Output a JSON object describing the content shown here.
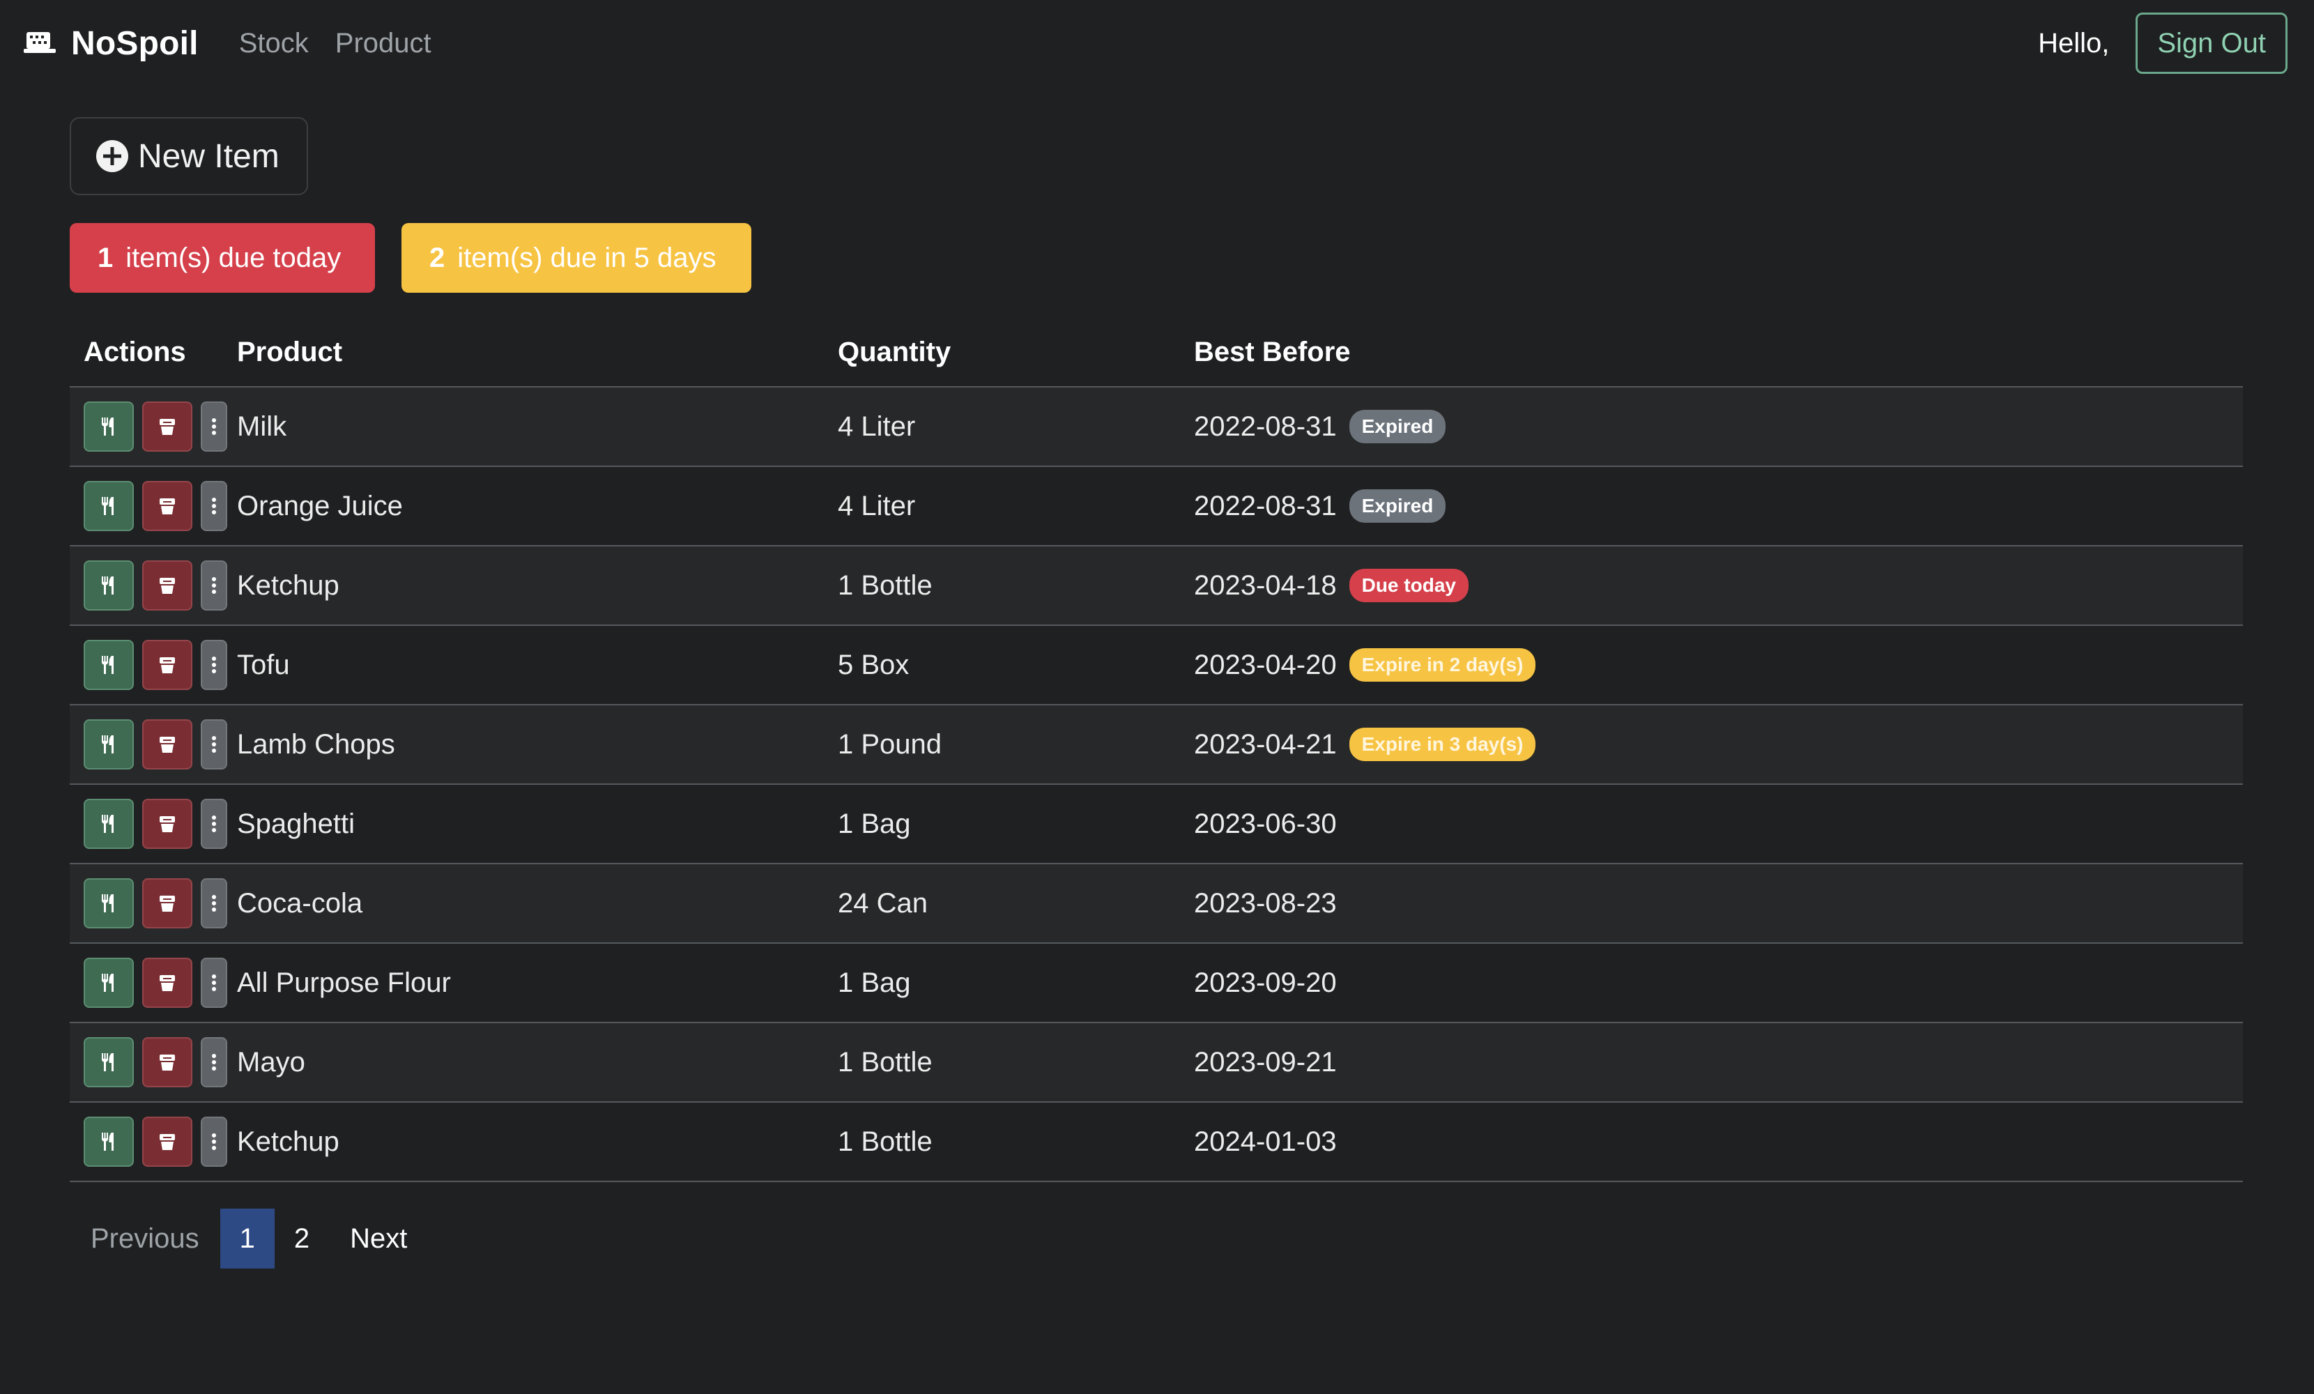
{
  "navbar": {
    "brand": "NoSpoil",
    "links": [
      "Stock",
      "Product"
    ],
    "greeting": "Hello,",
    "sign_out": "Sign Out"
  },
  "toolbar": {
    "new_item_label": "New Item"
  },
  "alerts": {
    "due_today": {
      "count": "1",
      "text": "item(s) due today",
      "color": "#d5404b"
    },
    "due_soon": {
      "count": "2",
      "text": "item(s) due in 5 days",
      "color": "#f7c343"
    }
  },
  "table": {
    "headers": [
      "Actions",
      "Product",
      "Quantity",
      "Best Before"
    ],
    "rows": [
      {
        "product": "Milk",
        "quantity": "4 Liter",
        "best_before": "2022-08-31",
        "badge": "Expired",
        "badge_type": "gray"
      },
      {
        "product": "Orange Juice",
        "quantity": "4 Liter",
        "best_before": "2022-08-31",
        "badge": "Expired",
        "badge_type": "gray"
      },
      {
        "product": "Ketchup",
        "quantity": "1 Bottle",
        "best_before": "2023-04-18",
        "badge": "Due today",
        "badge_type": "red"
      },
      {
        "product": "Tofu",
        "quantity": "5 Box",
        "best_before": "2023-04-20",
        "badge": "Expire in 2 day(s)",
        "badge_type": "yellow"
      },
      {
        "product": "Lamb Chops",
        "quantity": "1 Pound",
        "best_before": "2023-04-21",
        "badge": "Expire in 3 day(s)",
        "badge_type": "yellow"
      },
      {
        "product": "Spaghetti",
        "quantity": "1 Bag",
        "best_before": "2023-06-30",
        "badge": "",
        "badge_type": ""
      },
      {
        "product": "Coca-cola",
        "quantity": "24 Can",
        "best_before": "2023-08-23",
        "badge": "",
        "badge_type": ""
      },
      {
        "product": "All Purpose Flour",
        "quantity": "1 Bag",
        "best_before": "2023-09-20",
        "badge": "",
        "badge_type": ""
      },
      {
        "product": "Mayo",
        "quantity": "1 Bottle",
        "best_before": "2023-09-21",
        "badge": "",
        "badge_type": ""
      },
      {
        "product": "Ketchup",
        "quantity": "1 Bottle",
        "best_before": "2024-01-03",
        "badge": "",
        "badge_type": ""
      }
    ],
    "row_action_icons": [
      "utensils-icon",
      "trash-bin-icon",
      "more-vertical-icon"
    ]
  },
  "pagination": {
    "previous": "Previous",
    "pages": [
      "1",
      "2"
    ],
    "current": "1",
    "next": "Next"
  },
  "colors": {
    "background": "#1f2021",
    "primary": "#2d4a85",
    "success": "#3e6b52",
    "danger": "#d5404b",
    "warning": "#f7c343"
  }
}
